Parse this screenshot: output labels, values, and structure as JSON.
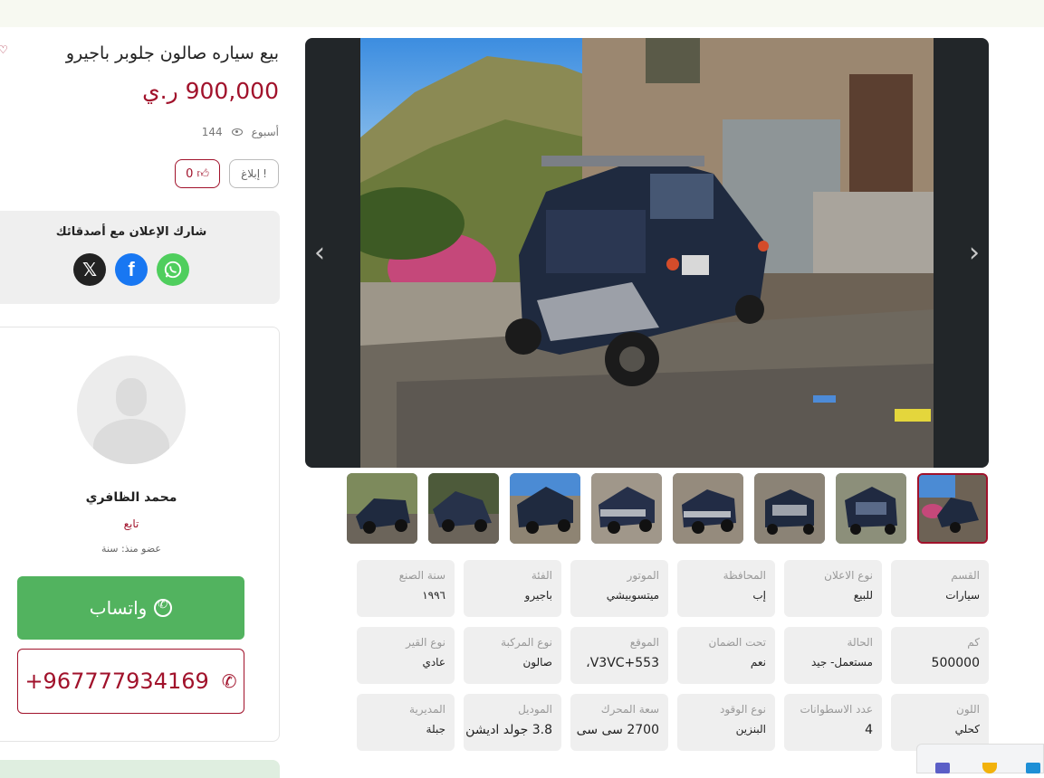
{
  "listing": {
    "title": "بيع سياره صالون جلوبر باجيرو",
    "price": "900,000 ر.ي",
    "age": "أسبوع",
    "views": "144",
    "report_label": "إبلاغ",
    "likes": "0"
  },
  "share": {
    "title": "شارك الإعلان مع أصدقائك",
    "networks": [
      "x-icon",
      "facebook-icon",
      "whatsapp-icon"
    ]
  },
  "seller": {
    "name": "محمد الظافري",
    "follow_label": "تابع",
    "member_since": "عضو منذ: سنة",
    "whatsapp_label": "واتساب",
    "phone": "+967777934169"
  },
  "gallery": {
    "thumb_count": 8,
    "active_index": 7
  },
  "specs": [
    {
      "label": "القسم",
      "value": "سيارات"
    },
    {
      "label": "نوع الاعلان",
      "value": "للبيع"
    },
    {
      "label": "المحافظة",
      "value": "إب"
    },
    {
      "label": "الموتور",
      "value": "ميتسوبيشي"
    },
    {
      "label": "الفئة",
      "value": "باجيرو"
    },
    {
      "label": "سنة الصنع",
      "value": "١٩٩٦"
    },
    {
      "label": "كم",
      "value": "500000"
    },
    {
      "label": "الحالة",
      "value": "مستعمل- جيد"
    },
    {
      "label": "تحت الضمان",
      "value": "نعم"
    },
    {
      "label": "الموقع",
      "value": "V3VC+553،"
    },
    {
      "label": "نوع المركبة",
      "value": "صالون"
    },
    {
      "label": "نوع القير",
      "value": "عادي"
    },
    {
      "label": "اللون",
      "value": "كحلي"
    },
    {
      "label": "عدد الاسطوانات",
      "value": "4"
    },
    {
      "label": "نوع الوقود",
      "value": "البنزين"
    },
    {
      "label": "سعة المحرك",
      "value": "2700 سى سى"
    },
    {
      "label": "الموديل",
      "value": "3.8 جولد اديشن"
    },
    {
      "label": "المديرية",
      "value": "جبلة"
    }
  ],
  "colors": {
    "accent": "#a1122b",
    "whatsapp": "#52b35f",
    "facebook": "#1877f2"
  }
}
